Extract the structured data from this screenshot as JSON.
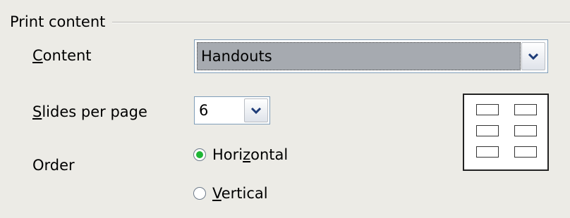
{
  "section": {
    "title": "Print content"
  },
  "content": {
    "label_mnemonic": "C",
    "label_rest": "ontent",
    "value": "Handouts"
  },
  "slides_per_page": {
    "label_mnemonic": "S",
    "label_rest": "lides per page",
    "value": "6"
  },
  "order": {
    "label": "Order",
    "options": [
      {
        "pre": "Hori",
        "mnemonic": "z",
        "post": "ontal",
        "checked": true
      },
      {
        "pre": "",
        "mnemonic": "V",
        "post": "ertical",
        "checked": false
      }
    ]
  },
  "icons": {
    "dropdown": "chevron-down-icon",
    "preview": "handout-layout-preview"
  },
  "colors": {
    "radio_selected": "#1fb636",
    "combo_highlight": "#a6aab0"
  }
}
